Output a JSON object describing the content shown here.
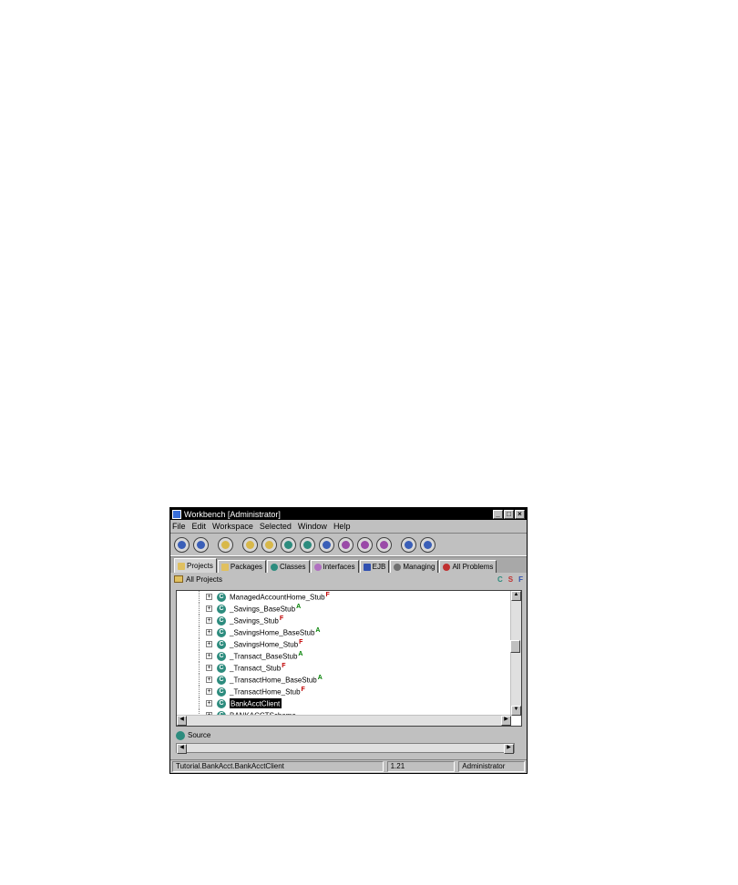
{
  "window": {
    "title": "Workbench [Administrator]",
    "controls": [
      "_",
      "□",
      "×"
    ]
  },
  "menu": [
    "File",
    "Edit",
    "Workspace",
    "Selected",
    "Window",
    "Help"
  ],
  "tabs": [
    {
      "label": "Projects",
      "icon": "folder-icon"
    },
    {
      "label": "Packages",
      "icon": "packages-icon"
    },
    {
      "label": "Classes",
      "icon": "class-icon"
    },
    {
      "label": "Interfaces",
      "icon": "interface-icon"
    },
    {
      "label": "EJB",
      "icon": "ejb-icon"
    },
    {
      "label": "Managing",
      "icon": "managing-icon"
    },
    {
      "label": "All Problems",
      "icon": "problems-icon"
    }
  ],
  "nav": {
    "label": "All Projects",
    "indicators": [
      "C",
      "S",
      "F"
    ]
  },
  "tree": {
    "rows": [
      {
        "name": "ManagedAccountHome_Stub",
        "mod": "F"
      },
      {
        "name": "_Savings_BaseStub",
        "mod": "A"
      },
      {
        "name": "_Savings_Stub",
        "mod": "F"
      },
      {
        "name": "_SavingsHome_BaseStub",
        "mod": "A"
      },
      {
        "name": "_SavingsHome_Stub",
        "mod": "F"
      },
      {
        "name": "_Transact_BaseStub",
        "mod": "A"
      },
      {
        "name": "_Transact_Stub",
        "mod": "F"
      },
      {
        "name": "_TransactHome_BaseStub",
        "mod": "A"
      },
      {
        "name": "_TransactHome_Stub",
        "mod": "F"
      },
      {
        "name": "BankAcctClient",
        "mod": "",
        "selected": true
      },
      {
        "name": "BANKACCTSchema",
        "mod": ""
      }
    ]
  },
  "source": {
    "label": "Source"
  },
  "status": {
    "path": "Tutorial.BankAcct.BankAcctClient",
    "version": "1.21",
    "user": "Administrator"
  }
}
